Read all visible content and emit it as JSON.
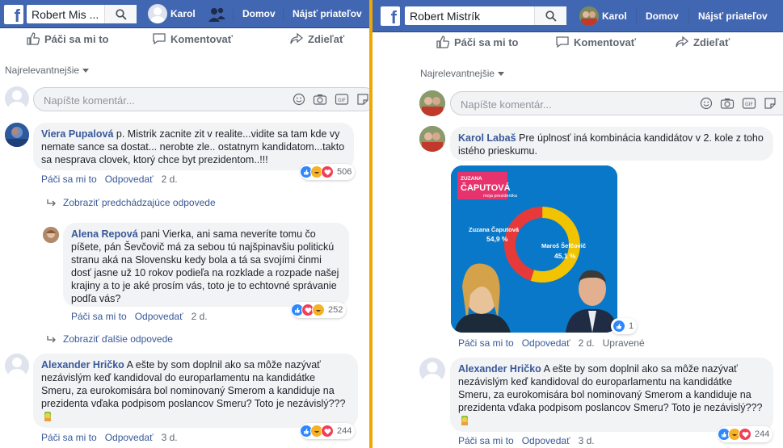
{
  "left": {
    "search_value": "Robert Mis ...",
    "nav": {
      "profile_name": "Karol",
      "home": "Domov",
      "find_friends": "Nájsť priateľov"
    },
    "actions": {
      "like": "Páči sa mi to",
      "comment": "Komentovať",
      "share": "Zdieľať"
    },
    "sort_label": "Najrelevantnejšie",
    "comment_placeholder": "Napíšte komentár...",
    "comments": [
      {
        "author": "Viera Pupalová",
        "text": "p. Mistrik zacnite zit v realite...vidite sa tam kde vy nemate sance sa dostat... nerobte zle.. ostatnym kandidatom...takto sa nesprava clovek, ktorý chce byt prezidentom..!!!",
        "like": "Páči sa mi to",
        "reply": "Odpovedať",
        "time": "2 d.",
        "reactions": "506"
      },
      {
        "author": "Alena Repová",
        "text": "pani Vierka, ani sama neveríte tomu čo píšete, pán Ševčovič má za sebou tú najšpinavšiu politickú stranu aká na Slovensku kedy bola a tá sa svojími činmi dosť jasne už 10 rokov podieľa na rozklade a rozpade našej krajiny a to je aké prosím vás, toto je to echtovné správanie podľa vás?",
        "like": "Páči sa mi to",
        "reply": "Odpovedať",
        "time": "2 d.",
        "reactions": "252"
      },
      {
        "author": "Alexander Hričko",
        "text": "A ešte by som doplnil ako sa môže nazývať nezávislým keď kandidoval do europarlamentu na kandidátke Smeru, za eurokomisára bol nominovaný Smerom a kandiduje na prezidenta vďaka podpisom poslancov Smeru? Toto je nezávislý???",
        "like": "Páči sa mi to",
        "reply": "Odpovedať",
        "time": "3 d.",
        "reactions": "244"
      }
    ],
    "view_previous": "Zobraziť predchádzajúce odpovede",
    "view_more": "Zobraziť ďalšie odpovede"
  },
  "right": {
    "search_value": "Robert Mistrík",
    "nav": {
      "profile_name": "Karol",
      "home": "Domov",
      "find_friends": "Nájsť priateľov"
    },
    "actions": {
      "like": "Páči sa mi to",
      "comment": "Komentovať",
      "share": "Zdieľať"
    },
    "sort_label": "Najrelevantnejšie",
    "comment_placeholder": "Napíšte komentár...",
    "karol_comment": {
      "author": "Karol Labaš",
      "text": "Pre úplnosť iná kombinácia kandidátov v 2. kole z toho istého prieskumu.",
      "like": "Páči sa mi to",
      "reply": "Odpovedať",
      "time": "2 d.",
      "edited": "Upravené",
      "reactions": "1"
    },
    "poster": {
      "brand_small": "ZUZANA",
      "brand_big": "ČAPUTOVÁ",
      "brand_tag": "moja prezidentka",
      "candidate_a": "Zuzana Čaputová",
      "candidate_a_value": "54,9 %",
      "candidate_b": "Maroš Šefčovič",
      "candidate_b_value": "45,1 %",
      "share_a": 54.9,
      "color_a": "#f2c300",
      "color_b": "#e63a3a"
    },
    "hricko_comment": {
      "author": "Alexander Hričko",
      "text": "A ešte by som doplnil ako sa môže nazývať nezávislým keď kandidoval do europarlamentu na kandidátke Smeru, za eurokomisára bol nominovaný Smerom a kandiduje na prezidenta vďaka podpisom poslancov Smeru? Toto je nezávislý???",
      "like": "Páči sa mi to",
      "reply": "Odpovedať",
      "time": "3 d.",
      "reactions": "244"
    }
  },
  "colors": {
    "fb_blue": "#4267b2",
    "link": "#385898",
    "divider": "#f0a800"
  }
}
